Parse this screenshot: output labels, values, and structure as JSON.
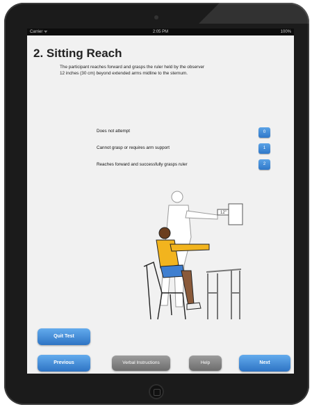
{
  "status_bar": {
    "carrier": "Carrier ᯤ",
    "time": "2:05 PM",
    "battery": "100%"
  },
  "page": {
    "title": "2.  Sitting Reach",
    "description_line1": "The participant reaches forward and grasps the ruler held by the observer",
    "description_line2": "12 inches (30 cm) beyond extended arms midline to the sternum."
  },
  "options": [
    {
      "label": "Does not attempt",
      "score": "0"
    },
    {
      "label": "Cannot grasp or requires arm support",
      "score": "1"
    },
    {
      "label": "Reaches forward and successfully grasps ruler",
      "score": "2"
    }
  ],
  "illustration": {
    "ruler_label": "12\""
  },
  "buttons": {
    "quit": "Quit Test",
    "previous": "Previous",
    "verbal": "Verbal Instructions",
    "help": "Help",
    "next": "Next"
  },
  "colors": {
    "accent_blue": "#3a86d4",
    "neutral_gray": "#8a8a8a",
    "shirt_yellow": "#f2b41e",
    "shorts_blue": "#3f7fd0"
  },
  "icons": [
    "wifi-icon",
    "battery-icon",
    "home-button",
    "camera"
  ]
}
